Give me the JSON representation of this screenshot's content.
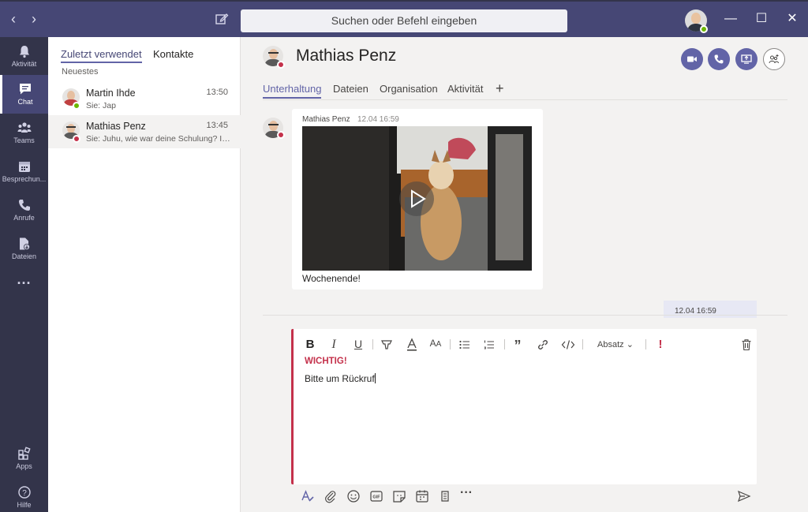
{
  "titlebar": {
    "search_placeholder": "Suchen oder Befehl eingeben",
    "colors": {
      "bar": "#464775",
      "rail": "#33344a",
      "accent": "#6264a7",
      "important": "#c4314b",
      "presence_available": "#6bb700",
      "presence_busy": "#c4314b"
    }
  },
  "rail": {
    "items": [
      {
        "label": "Aktivität",
        "icon": "bell-icon"
      },
      {
        "label": "Chat",
        "icon": "chat-icon"
      },
      {
        "label": "Teams",
        "icon": "teams-icon"
      },
      {
        "label": "Besprechun...",
        "icon": "calendar-icon"
      },
      {
        "label": "Anrufe",
        "icon": "phone-icon"
      },
      {
        "label": "Dateien",
        "icon": "files-icon"
      }
    ],
    "bottom": [
      {
        "label": "Apps",
        "icon": "apps-icon"
      },
      {
        "label": "Hilfe",
        "icon": "help-icon"
      }
    ]
  },
  "chatlist": {
    "tabs": [
      "Zuletzt verwendet",
      "Kontakte"
    ],
    "section": "Neuestes",
    "chats": [
      {
        "name": "Martin Ihde",
        "time": "13:50",
        "preview": "Sie: Jap",
        "presence": "available"
      },
      {
        "name": "Mathias Penz",
        "time": "13:45",
        "preview": "Sie: Juhu, wie war deine Schulung? Ic...",
        "presence": "busy"
      }
    ]
  },
  "main": {
    "contact_name": "Mathias Penz",
    "tabs": [
      "Unterhaltung",
      "Dateien",
      "Organisation",
      "Aktivität"
    ],
    "message": {
      "author": "Mathias Penz",
      "time": "12.04 16:59",
      "text": "Wochenende!"
    },
    "my_time": "12.04 16:59"
  },
  "compose": {
    "format_style": "Absatz",
    "importance_label": "WICHTIG!",
    "text": "Bitte um Rückruf"
  }
}
